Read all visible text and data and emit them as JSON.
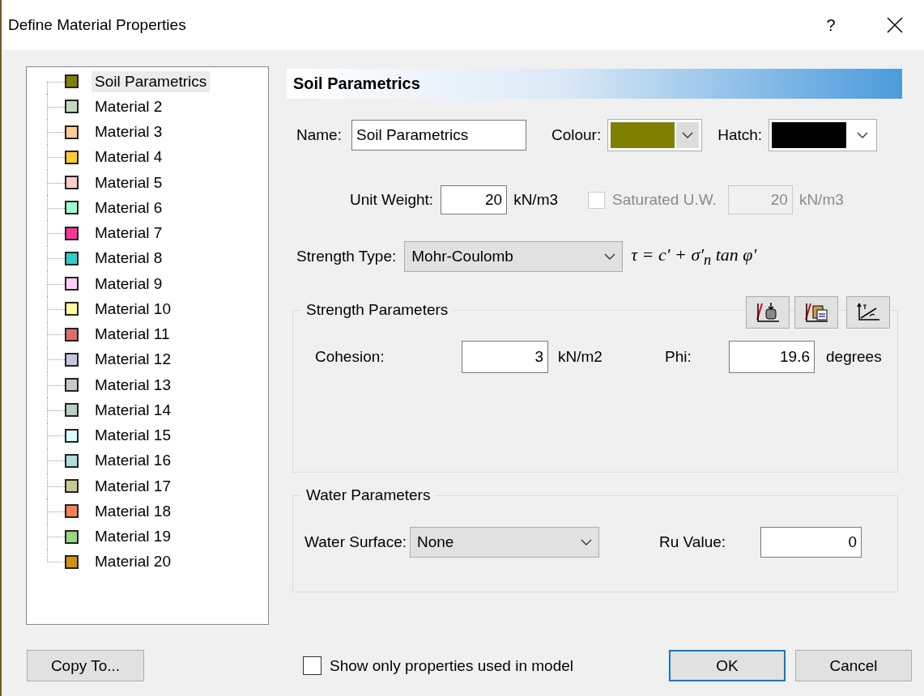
{
  "window": {
    "title": "Define Material Properties",
    "help": "?"
  },
  "materials": [
    {
      "name": "Soil Parametrics",
      "color": "#808000",
      "selected": true
    },
    {
      "name": "Material 2",
      "color": "#c0dcc0",
      "selected": false
    },
    {
      "name": "Material 3",
      "color": "#ffcc99",
      "selected": false
    },
    {
      "name": "Material 4",
      "color": "#ffcc33",
      "selected": false
    },
    {
      "name": "Material 5",
      "color": "#ffcccc",
      "selected": false
    },
    {
      "name": "Material 6",
      "color": "#99ffcc",
      "selected": false
    },
    {
      "name": "Material 7",
      "color": "#ff3399",
      "selected": false
    },
    {
      "name": "Material 8",
      "color": "#33cccc",
      "selected": false
    },
    {
      "name": "Material 9",
      "color": "#ffccff",
      "selected": false
    },
    {
      "name": "Material 10",
      "color": "#ffff99",
      "selected": false
    },
    {
      "name": "Material 11",
      "color": "#d87070",
      "selected": false
    },
    {
      "name": "Material 12",
      "color": "#c0c8dc",
      "selected": false
    },
    {
      "name": "Material 13",
      "color": "#c8c8c8",
      "selected": false
    },
    {
      "name": "Material 14",
      "color": "#b8d0c0",
      "selected": false
    },
    {
      "name": "Material 15",
      "color": "#d8ffff",
      "selected": false
    },
    {
      "name": "Material 16",
      "color": "#b0dcdc",
      "selected": false
    },
    {
      "name": "Material 17",
      "color": "#c8c890",
      "selected": false
    },
    {
      "name": "Material 18",
      "color": "#ff8050",
      "selected": false
    },
    {
      "name": "Material 19",
      "color": "#98d880",
      "selected": false
    },
    {
      "name": "Material 20",
      "color": "#d09010",
      "selected": false
    }
  ],
  "detail": {
    "title": "Soil Parametrics",
    "name": {
      "label": "Name:",
      "value": "Soil Parametrics"
    },
    "colour": {
      "label": "Colour:",
      "color": "#808000"
    },
    "hatch": {
      "label": "Hatch:",
      "color": "#000000"
    },
    "unit_weight": {
      "label": "Unit Weight:",
      "value": "20",
      "unit": "kN/m3"
    },
    "saturated": {
      "label": "Saturated U.W.",
      "checked": false,
      "disabled": true,
      "value": "20",
      "unit": "kN/m3"
    },
    "strength_type": {
      "label": "Strength Type:",
      "value": "Mohr-Coulomb",
      "formula": "τ = c′ + σ′$_{n}$ tan φ′"
    },
    "strength_parameters": {
      "title": "Strength Parameters",
      "tools": [
        {
          "kind": "import"
        },
        {
          "kind": "paste"
        },
        {
          "kind": "plot"
        }
      ],
      "cohesion": {
        "label": "Cohesion:",
        "value": "3",
        "unit": "kN/m2"
      },
      "phi": {
        "label": "Phi:",
        "value": "19.6",
        "unit": "degrees"
      }
    },
    "water_parameters": {
      "title": "Water Parameters",
      "water_surface": {
        "label": "Water Surface:",
        "value": "None"
      },
      "ru": {
        "label": "Ru Value:",
        "value": "0"
      }
    }
  },
  "footer": {
    "copy_to": "Copy To...",
    "show_only": {
      "label": "Show only properties used in model",
      "checked": false
    },
    "buttons": [
      {
        "label": "OK",
        "default": true
      },
      {
        "label": "Cancel",
        "default": false
      }
    ]
  }
}
